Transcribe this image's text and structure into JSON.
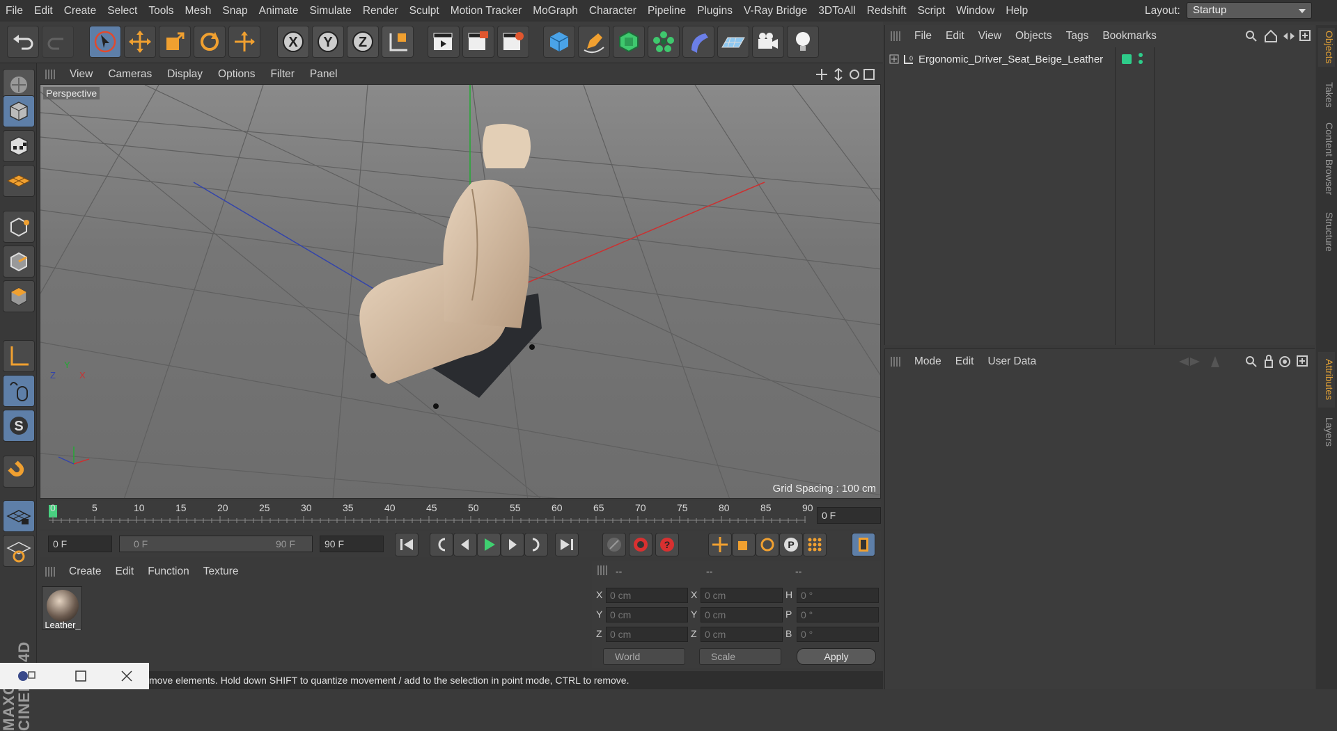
{
  "menubar": {
    "items": [
      "File",
      "Edit",
      "Create",
      "Select",
      "Tools",
      "Mesh",
      "Snap",
      "Animate",
      "Simulate",
      "Render",
      "Sculpt",
      "Motion Tracker",
      "MoGraph",
      "Character",
      "Pipeline",
      "Plugins",
      "V-Ray Bridge",
      "3DToAll",
      "Redshift",
      "Script",
      "Window",
      "Help"
    ],
    "layout_label": "Layout:",
    "layout_value": "Startup"
  },
  "viewport": {
    "menu": [
      "View",
      "Cameras",
      "Display",
      "Options",
      "Filter",
      "Panel"
    ],
    "label": "Perspective",
    "grid_spacing": "Grid Spacing : 100 cm",
    "axis_x": "X",
    "axis_y": "Y",
    "axis_z": "Z"
  },
  "timeline": {
    "ticks": [
      "0",
      "5",
      "10",
      "15",
      "20",
      "25",
      "30",
      "35",
      "40",
      "45",
      "50",
      "55",
      "60",
      "65",
      "70",
      "75",
      "80",
      "85",
      "90"
    ],
    "current_frame": "0 F",
    "start_field": "0 F",
    "range_start": "0 F",
    "range_end": "90 F",
    "end_field": "90 F"
  },
  "materials": {
    "menu": [
      "Create",
      "Edit",
      "Function",
      "Texture"
    ],
    "items": [
      {
        "name": "Leather_"
      }
    ]
  },
  "coords": {
    "headers": [
      "--",
      "--",
      "--"
    ],
    "rows": [
      {
        "l1": "X",
        "v1": "0 cm",
        "l2": "X",
        "v2": "0 cm",
        "l3": "H",
        "v3": "0 °"
      },
      {
        "l1": "Y",
        "v1": "0 cm",
        "l2": "Y",
        "v2": "0 cm",
        "l3": "P",
        "v3": "0 °"
      },
      {
        "l1": "Z",
        "v1": "0 cm",
        "l2": "Z",
        "v2": "0 cm",
        "l3": "B",
        "v3": "0 °"
      }
    ],
    "world": "World",
    "scale": "Scale",
    "apply": "Apply"
  },
  "objects": {
    "menu": [
      "File",
      "Edit",
      "View",
      "Objects",
      "Tags",
      "Bookmarks"
    ],
    "object_name": "Ergonomic_Driver_Seat_Beige_Leather"
  },
  "attributes": {
    "menu": [
      "Mode",
      "Edit",
      "User Data"
    ]
  },
  "right_tabs": [
    "Objects",
    "Takes",
    "Content Browser",
    "Structure",
    "Attributes",
    "Layers"
  ],
  "status_text": "move elements. Hold down SHIFT to quantize movement / add to the selection in point mode, CTRL to remove.",
  "brand": "MAXON CINEMA 4D",
  "colors": {
    "accent": "#5e7fa8",
    "selected_tab": "#e0a036",
    "object_tag": "#2ecc8a"
  }
}
